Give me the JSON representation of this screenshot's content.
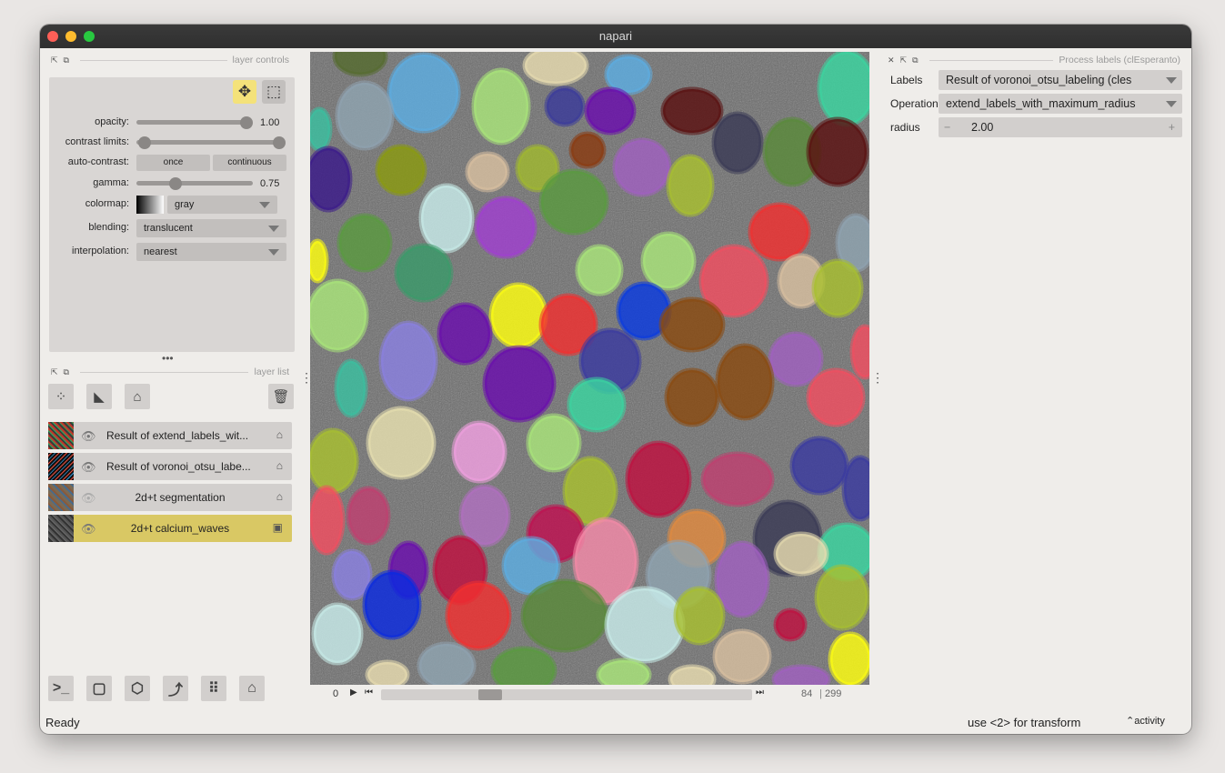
{
  "window": {
    "title": "napari"
  },
  "layer_controls": {
    "title": "layer controls",
    "opacity_label": "opacity:",
    "opacity_value": "1.00",
    "contrast_label": "contrast limits:",
    "auto_contrast_label": "auto-contrast:",
    "auto_once": "once",
    "auto_continuous": "continuous",
    "gamma_label": "gamma:",
    "gamma_value": "0.75",
    "colormap_label": "colormap:",
    "colormap_value": "gray",
    "blending_label": "blending:",
    "blending_value": "translucent",
    "interpolation_label": "interpolation:",
    "interpolation_value": "nearest"
  },
  "layer_list": {
    "title": "layer list",
    "layers": [
      {
        "name": "Result of extend_labels_wit...",
        "visible": true
      },
      {
        "name": "Result of voronoi_otsu_labe...",
        "visible": true
      },
      {
        "name": "2d+t segmentation",
        "visible": false
      },
      {
        "name": "2d+t calcium_waves",
        "visible": true,
        "selected": true
      }
    ]
  },
  "dims": {
    "current": "0",
    "frame": "84",
    "total": "299",
    "slider_fraction": 0.28
  },
  "process_panel": {
    "title": "Process labels (clEsperanto)",
    "labels_label": "Labels",
    "labels_value": "Result of voronoi_otsu_labeling (cles",
    "operation_label": "Operation",
    "operation_value": "extend_labels_with_maximum_radius",
    "radius_label": "radius",
    "radius_minus": "−",
    "radius_value": "2.00",
    "radius_plus": "+"
  },
  "status": {
    "left": "Ready",
    "hint": "use <2> for transform",
    "activity": "activity"
  }
}
